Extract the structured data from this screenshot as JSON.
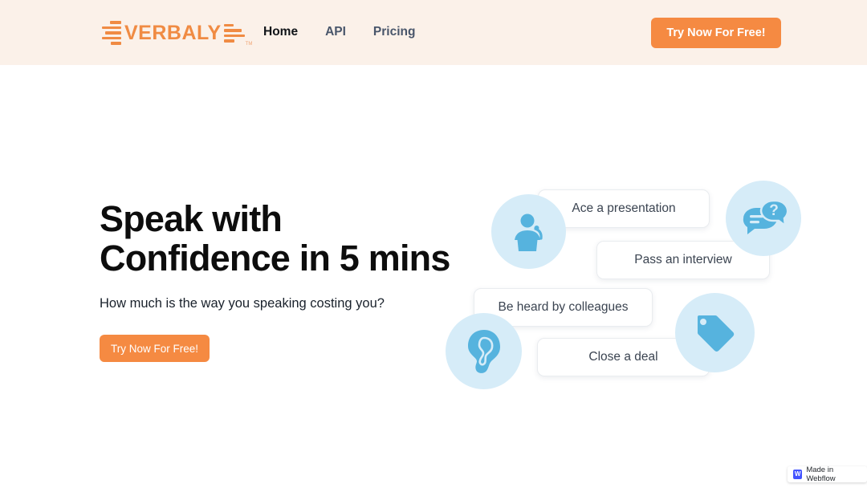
{
  "header": {
    "logo": {
      "word": "VERBALY",
      "tm": "TM",
      "icon": "sound-bars-icon"
    },
    "nav": [
      {
        "label": "Home",
        "active": true
      },
      {
        "label": "API",
        "active": false
      },
      {
        "label": "Pricing",
        "active": false
      }
    ],
    "cta_label": "Try Now For Free!",
    "background_color": "#FBF1E9",
    "accent_color": "#F58A42"
  },
  "hero": {
    "title": "Speak with\nConfidence in 5 mins",
    "subtitle": "How much is the way you speaking costing you?",
    "cta_label": "Try Now For Free!"
  },
  "illustration": {
    "bubbles": [
      {
        "label": "Ace a presentation"
      },
      {
        "label": "Pass an interview"
      },
      {
        "label": "Be heard by colleagues"
      },
      {
        "label": "Close a deal"
      }
    ],
    "icons": [
      {
        "name": "podium-speaker-icon"
      },
      {
        "name": "question-chat-bubbles-icon"
      },
      {
        "name": "ear-icon"
      },
      {
        "name": "price-tag-icon"
      }
    ],
    "icon_color": "#56B3DE",
    "blob_color": "#D6ECF8"
  },
  "footer_badge": {
    "label": "Made in Webflow",
    "mark": "W",
    "mark_color": "#4353FF"
  }
}
